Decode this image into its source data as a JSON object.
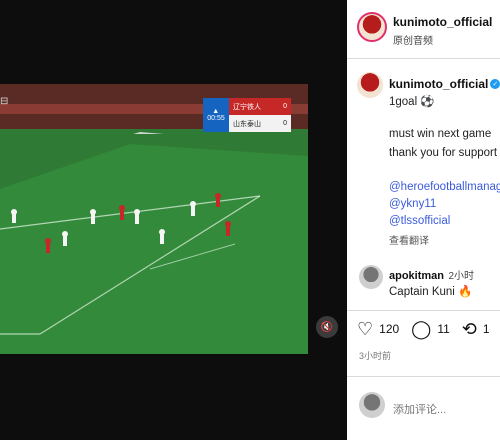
{
  "header": {
    "username": "kunimoto_official",
    "subtitle": "原创音频"
  },
  "caption": {
    "username": "kunimoto_official",
    "time": "3",
    "lines": [
      "1goal ⚽",
      "must win next game",
      "thank you for support"
    ],
    "mentions": [
      "@heroefootballmanage",
      "@ykny11",
      "@tlssofficial"
    ],
    "translate": "查看翻译"
  },
  "comment": {
    "username": "apokitman",
    "time": "2小时",
    "text": "Captain Kuni 🔥"
  },
  "actions": {
    "likes": "120",
    "comments": "11",
    "reposts": "1"
  },
  "posted_time": "3小时前",
  "add_comment_placeholder": "添加评论...",
  "video": {
    "home_team": "辽宁铁人",
    "home_score": "0",
    "away_team": "山东泰山",
    "away_score": "0",
    "clock": "00:55"
  },
  "colors": {
    "accent": "#3b5bdb",
    "verified": "#1d9bf0",
    "pitch": "#2f7a34"
  }
}
